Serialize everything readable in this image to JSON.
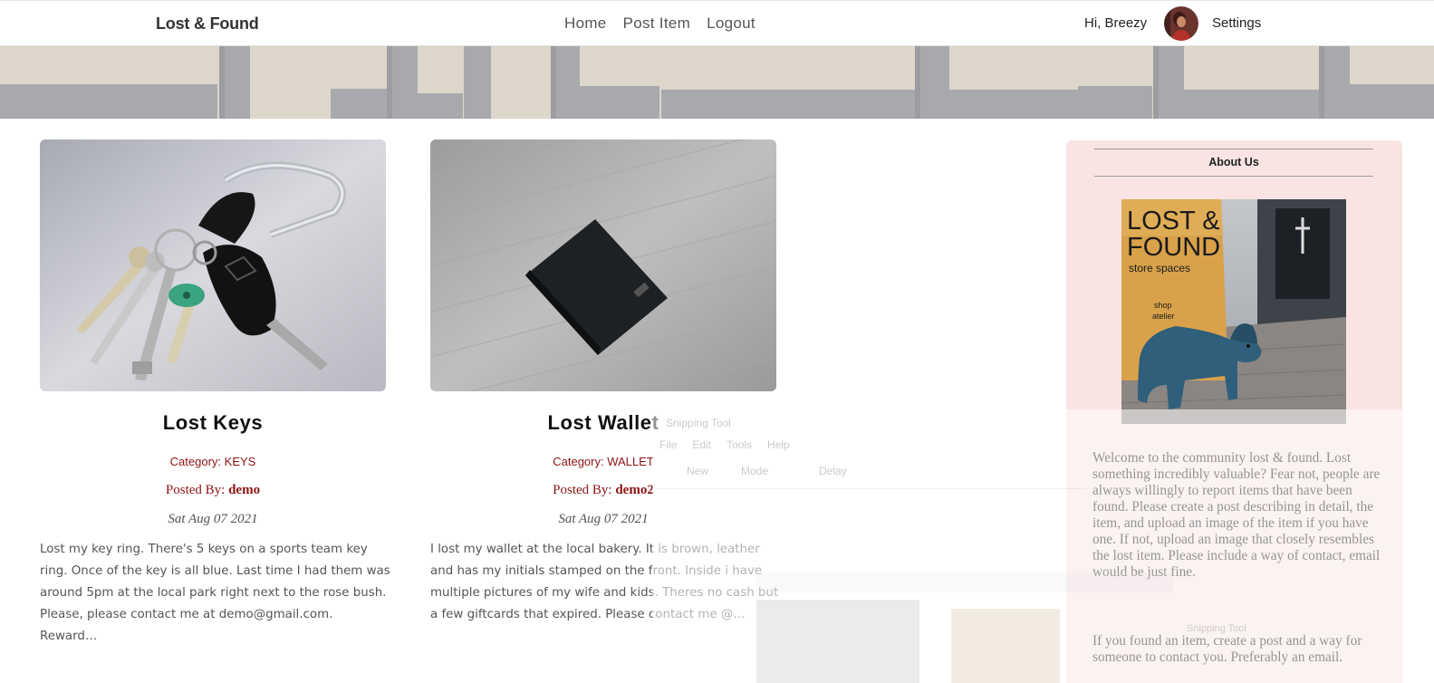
{
  "navbar": {
    "brand": "Lost & Found",
    "links": [
      "Home",
      "Post Item",
      "Logout"
    ],
    "greeting": "Hi, Breezy",
    "settings_label": "Settings"
  },
  "posts": [
    {
      "title": "Lost Keys",
      "category_label": "Category: KEYS",
      "posted_by_label": "Posted By:",
      "author": "demo",
      "date": "Sat Aug 07 2021",
      "body": "Lost my key ring. There's 5 keys on a sports team key ring. Once of the key is all blue. Last time I had them was around 5pm at the local park right next to the rose bush. Please, please contact me at demo@gmail.com. Reward…"
    },
    {
      "title": "Lost Wallet",
      "category_label": "Category: WALLET",
      "posted_by_label": "Posted By:",
      "author": "demo2",
      "date": "Sat Aug 07 2021",
      "body": "I lost my wallet at the local bakery. It is brown, leather and has my initials stamped on the front. Inside i have multiple pictures of my wife and kids. Theres no cash but a few giftcards that expired. Please contact me @…"
    }
  ],
  "sidebar": {
    "title": "About Us",
    "image_text": {
      "line1": "LOST &",
      "line2": "FOUND",
      "line3": "store spaces",
      "line4": "shop",
      "line5": "atelier"
    },
    "paragraph_1": "Welcome to the community lost & found. Lost something incredibly valuable? Fear not, people are always willingly to report items that have been found. Please create a post describing in detail, the item, and upload an image of the item if you have one. If not, upload an image that closely resembles the lost item. Please include a way of contact, email would be just fine.",
    "paragraph_2": "If you found an item, create a post and a way for someone to contact you. Preferably an email."
  },
  "snipping_tool": {
    "title": "Snipping Tool",
    "menu": [
      "File",
      "Edit",
      "Tools",
      "Help"
    ],
    "new_label": "New",
    "mode_label": "Mode",
    "delay_label": "Delay"
  },
  "colors": {
    "accent_red": "#8b1414",
    "sidebar_bg": "#f9e3e3",
    "banner_bg": "#dcd6cc"
  }
}
